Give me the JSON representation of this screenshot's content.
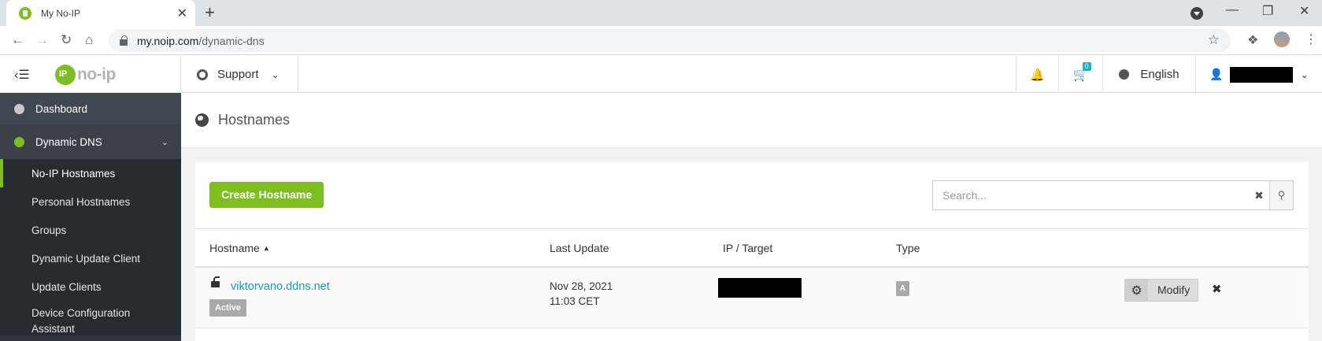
{
  "browser": {
    "tab_title": "My No-IP",
    "tab_close": "✕",
    "new_tab": "+",
    "url_host": "my.noip.com",
    "url_path": "/dynamic-dns"
  },
  "header": {
    "logo_text": "no-ip",
    "support_label": "Support",
    "cart_count": "0",
    "language_label": "English"
  },
  "sidebar": {
    "dashboard_label": "Dashboard",
    "dynamic_dns_label": "Dynamic DNS",
    "items": [
      {
        "label": "No-IP Hostnames"
      },
      {
        "label": "Personal Hostnames"
      },
      {
        "label": "Groups"
      },
      {
        "label": "Dynamic Update Client"
      },
      {
        "label": "Update Clients"
      },
      {
        "label": "Device Configuration Assistant"
      }
    ]
  },
  "main": {
    "page_title": "Hostnames",
    "create_button": "Create Hostname",
    "search_placeholder": "Search...",
    "columns": {
      "hostname": "Hostname",
      "last_update": "Last Update",
      "ip_target": "IP / Target",
      "type": "Type"
    },
    "rows": [
      {
        "hostname": "viktorvano.ddns.net",
        "status": "Active",
        "last_update_date": "Nov 28, 2021",
        "last_update_time": "11:03 CET",
        "type": "A",
        "modify_label": "Modify"
      }
    ]
  },
  "colors": {
    "brand_green": "#7fbe21",
    "link_blue": "#1a9bbd",
    "sidebar_bg": "#2e353d"
  }
}
